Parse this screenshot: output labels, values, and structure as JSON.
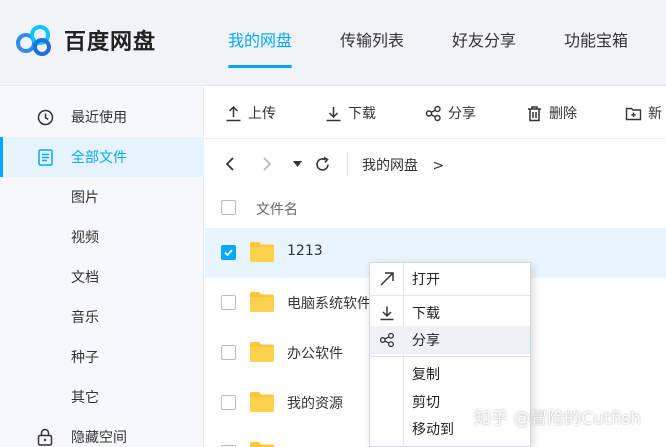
{
  "app": {
    "logo_text": "百度网盘",
    "brand_color": "#06a7ff"
  },
  "top_nav": {
    "items": [
      {
        "label": "我的网盘",
        "active": true
      },
      {
        "label": "传输列表",
        "active": false
      },
      {
        "label": "好友分享",
        "active": false
      },
      {
        "label": "功能宝箱",
        "active": false
      }
    ]
  },
  "sidebar": {
    "items": [
      {
        "label": "最近使用",
        "icon": "clock-icon"
      },
      {
        "label": "全部文件",
        "icon": "document-icon",
        "active": true
      },
      {
        "label": "图片"
      },
      {
        "label": "视频"
      },
      {
        "label": "文档"
      },
      {
        "label": "音乐"
      },
      {
        "label": "种子"
      },
      {
        "label": "其它"
      },
      {
        "label": "隐藏空间",
        "icon": "lock-icon"
      }
    ]
  },
  "toolbar": {
    "upload_label": "上传",
    "download_label": "下载",
    "share_label": "分享",
    "delete_label": "删除",
    "new_label": "新"
  },
  "breadcrumb": {
    "current": "我的网盘",
    "separator": ">"
  },
  "file_list": {
    "header_name": "文件名",
    "rows": [
      {
        "name": "1213",
        "checked": true
      },
      {
        "name": "电脑系统软件",
        "checked": false
      },
      {
        "name": "办公软件",
        "checked": false
      },
      {
        "name": "我的资源",
        "checked": false
      }
    ]
  },
  "context_menu": {
    "open_label": "打开",
    "download_label": "下载",
    "share_label": "分享",
    "copy_label": "复制",
    "cut_label": "剪切",
    "move_label": "移动到"
  },
  "watermark": "知乎 @冒险的Cutfish"
}
